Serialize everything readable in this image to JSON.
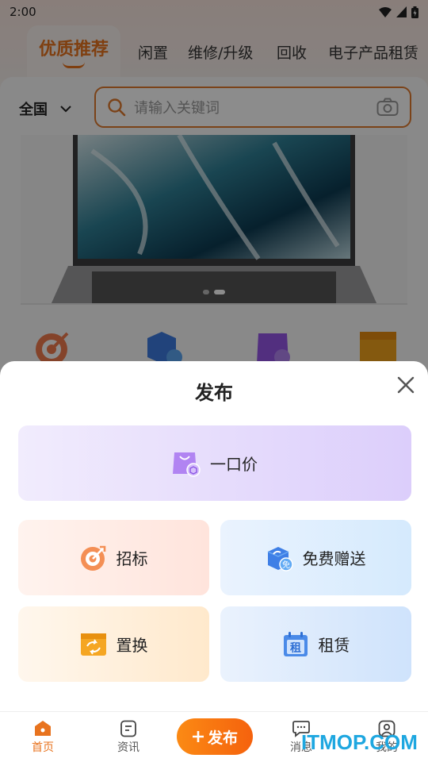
{
  "status_bar": {
    "time": "2:00"
  },
  "tabs": [
    {
      "label": "优质推荐",
      "active": true
    },
    {
      "label": "闲置"
    },
    {
      "label": "维修/升级"
    },
    {
      "label": "回收"
    },
    {
      "label": "电子产品租赁"
    }
  ],
  "region": {
    "label": "全国"
  },
  "search": {
    "placeholder": "请输入关键词"
  },
  "sheet": {
    "title": "发布",
    "options": {
      "fixed_price": {
        "label": "一口价",
        "icon": "shopping-bag-icon"
      },
      "bid": {
        "label": "招标",
        "icon": "target-icon"
      },
      "free_gift": {
        "label": "免费赠送",
        "icon": "gift-box-icon"
      },
      "swap": {
        "label": "置换",
        "icon": "swap-icon"
      },
      "rent": {
        "label": "租赁",
        "icon": "calendar-rent-icon"
      }
    },
    "rent_icon_text": "租",
    "free_badge_text": "免"
  },
  "bottom_nav": {
    "home": "首页",
    "news": "资讯",
    "publish": "发布",
    "messages": "消息",
    "mine": "我的"
  },
  "watermark": "ITMOP.COM",
  "colors": {
    "accent": "#e8731e",
    "publish_button": "#f97a10",
    "search_border": "#e07a2e",
    "watermark": "#1ea7e0"
  }
}
